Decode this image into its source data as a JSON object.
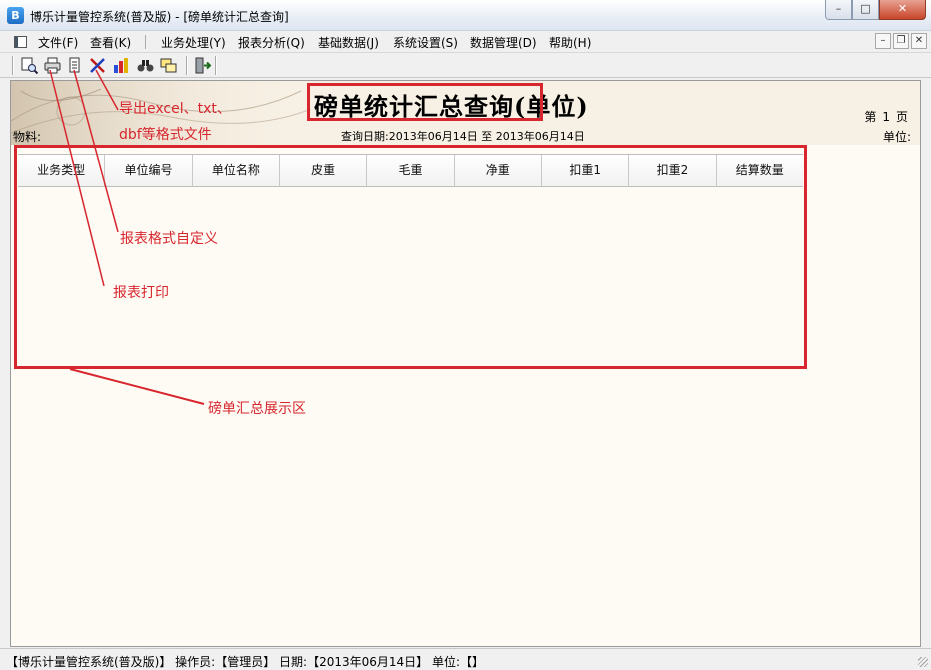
{
  "window": {
    "title": "博乐计量管控系统(普及版)  - [磅单统计汇总查询]",
    "app_icon_letter": "B",
    "controls": {
      "minimize": "–",
      "maximize": "□",
      "close": "✕"
    }
  },
  "menubar": {
    "items": [
      "文件(F)",
      "查看(K)",
      "业务处理(Y)",
      "报表分析(Q)",
      "基础数据(J)",
      "系统设置(S)",
      "数据管理(D)",
      "帮助(H)"
    ],
    "mdi_controls": {
      "minimize": "–",
      "restore": "❐",
      "close": "✕"
    }
  },
  "toolbar": {
    "buttons": [
      "preview-icon",
      "print-icon",
      "format-icon",
      "export-icon",
      "chart-icon",
      "find-icon",
      "copy-icon",
      "exit-icon"
    ]
  },
  "report": {
    "title": "磅单统计汇总查询(单位)",
    "page_prefix": "第",
    "page_number": "1",
    "page_suffix": "页",
    "material_label": "物料:",
    "query_date_label": "查询日期:",
    "date_from": "2013年06月14日",
    "date_to_sep": "至",
    "date_to": "2013年06月14日",
    "unit_label": "单位:",
    "columns": [
      "业务类型",
      "单位编号",
      "单位名称",
      "皮重",
      "毛重",
      "净重",
      "扣重1",
      "扣重2",
      "结算数量"
    ]
  },
  "annotations": {
    "export_line1": "导出excel、txt、",
    "export_line2": "dbf等格式文件",
    "custom_format": "报表格式自定义",
    "print": "报表打印",
    "display_area": "磅单汇总展示区"
  },
  "colors": {
    "annotation": "#d7262e"
  },
  "statusbar": {
    "text": "【博乐计量管控系统(普及版)】  操作员:【管理员】  日期:【2013年06月14日】  单位:【】"
  }
}
